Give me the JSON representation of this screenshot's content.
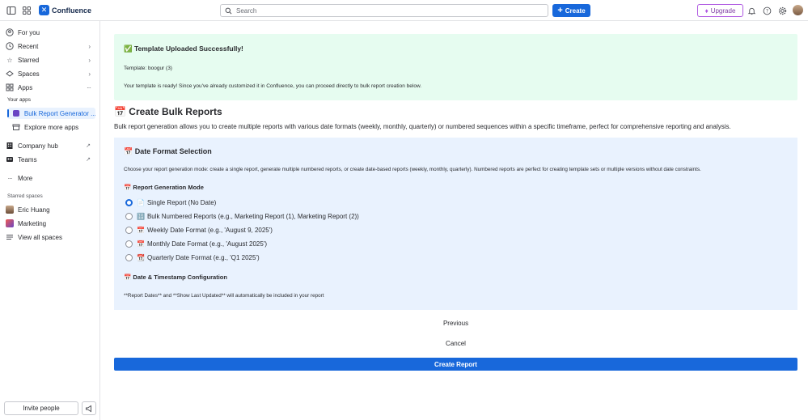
{
  "topbar": {
    "app_name": "Confluence",
    "search_placeholder": "Search",
    "create_label": "Create",
    "upgrade_label": "Upgrade"
  },
  "sidebar": {
    "for_you": "For you",
    "recent": "Recent",
    "starred": "Starred",
    "spaces": "Spaces",
    "apps": "Apps",
    "your_apps_heading": "Your apps",
    "bulk_app": "Bulk Report Generator ...",
    "explore_apps": "Explore more apps",
    "company_hub": "Company hub",
    "teams": "Teams",
    "more": "More",
    "starred_spaces_heading": "Starred spaces",
    "starred_spaces": [
      "Eric Huang",
      "Marketing"
    ],
    "view_all_spaces": "View all spaces",
    "invite_people": "Invite people"
  },
  "success": {
    "title": "✅ Template Uploaded Successfully!",
    "template_line": "Template: boogur (3)",
    "message": "Your template is ready! Since you've already customized it in Confluence, you can proceed directly to bulk report creation below."
  },
  "create": {
    "heading": "📅 Create Bulk Reports",
    "description": "Bulk report generation allows you to create multiple reports with various date formats (weekly, monthly, quarterly) or numbered sequences within a specific timeframe, perfect for comprehensive reporting and analysis."
  },
  "format": {
    "heading": "📅 Date Format Selection",
    "description": "Choose your report generation mode: create a single report, generate multiple numbered reports, or create date-based reports (weekly, monthly, quarterly). Numbered reports are perfect for creating template sets or multiple versions without date constraints.",
    "mode_heading": "📅 Report Generation Mode",
    "options": [
      {
        "emoji": "📄",
        "label": "Single Report (No Date)",
        "checked": true
      },
      {
        "emoji": "🔢",
        "label": "Bulk Numbered Reports (e.g., Marketing Report (1), Marketing Report (2))",
        "checked": false
      },
      {
        "emoji": "📅",
        "label": "Weekly Date Format (e.g., 'August 9, 2025')",
        "checked": false
      },
      {
        "emoji": "📅",
        "label": "Monthly Date Format (e.g., 'August 2025')",
        "checked": false
      },
      {
        "emoji": "📆",
        "label": "Quarterly Date Format (e.g., 'Q1 2025')",
        "checked": false
      }
    ],
    "date_heading": "📅 Date & Timestamp Configuration",
    "date_description": "**Report Dates** and **Show Last Updated** will automatically be included in your report"
  },
  "actions": {
    "previous": "Previous",
    "cancel": "Cancel",
    "create_report": "Create Report"
  },
  "colors": {
    "brand": "#1868DB",
    "success_bg": "#E6FCF0",
    "panel_bg": "#E9F2FE",
    "upgrade": "#AF59E1"
  }
}
